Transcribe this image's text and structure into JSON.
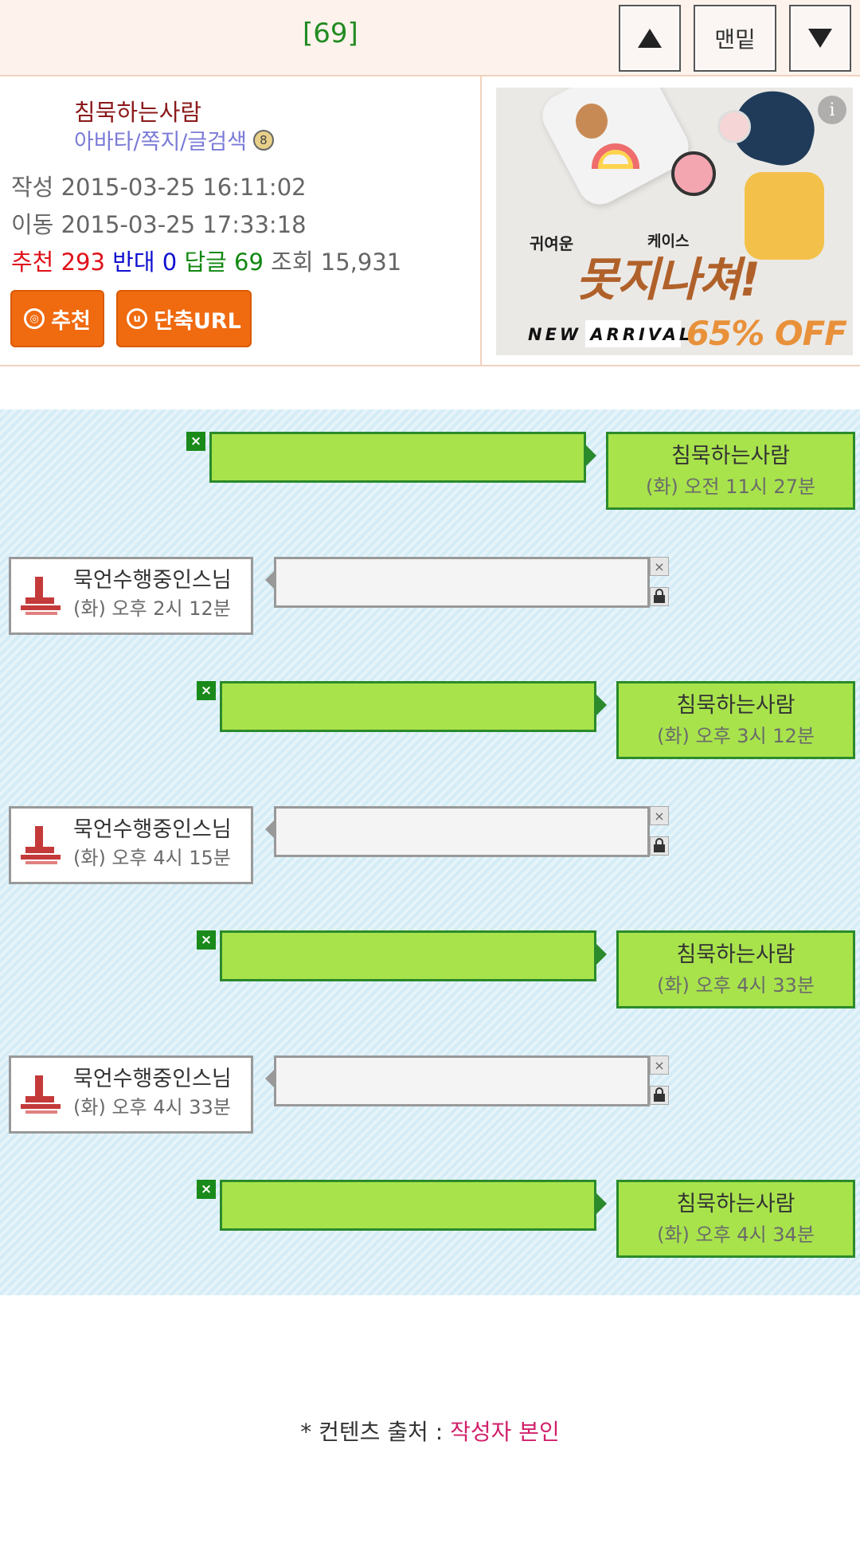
{
  "topbar": {
    "reply_count": "[69]",
    "up_label": "▲",
    "bottom_label": "맨밑",
    "down_label": "▼"
  },
  "post": {
    "author": "침묵하는사람",
    "author_links": "아바타/쪽지/글검색",
    "written_label": "작성",
    "written_at": "2015-03-25 16:11:02",
    "moved_label": "이동",
    "moved_at": "2015-03-25 17:33:18",
    "stats": {
      "recommend_label": "추천",
      "recommend": "293",
      "oppose_label": "반대",
      "oppose": "0",
      "reply_label": "답글",
      "replies": "69",
      "views_label": "조회",
      "views": "15,931"
    },
    "buttons": {
      "recommend": "추천",
      "short_url": "단축URL"
    }
  },
  "ad": {
    "small_left": "귀여운",
    "small_right": "케이스",
    "headline": "못지나쳐!",
    "new_arrival": "NEW ARRIVAL",
    "discount": "65% OFF",
    "info_icon": "i"
  },
  "chat": {
    "messages": [
      {
        "side": "right",
        "name": "침묵하는사람",
        "time": "(화) 오전 11시 27분"
      },
      {
        "side": "left",
        "name": "묵언수행중인스님",
        "time": "(화) 오후 2시 12분"
      },
      {
        "side": "right",
        "name": "침묵하는사람",
        "time": "(화) 오후 3시 12분"
      },
      {
        "side": "left",
        "name": "묵언수행중인스님",
        "time": "(화) 오후 4시 15분"
      },
      {
        "side": "right",
        "name": "침묵하는사람",
        "time": "(화) 오후 4시 33분"
      },
      {
        "side": "left",
        "name": "묵언수행중인스님",
        "time": "(화) 오후 4시 33분"
      },
      {
        "side": "right",
        "name": "침묵하는사람",
        "time": "(화) 오후 4시 34분"
      }
    ]
  },
  "footer": {
    "source_prefix": "* 컨텐츠 출처 : ",
    "source_value": "작성자 본인"
  }
}
